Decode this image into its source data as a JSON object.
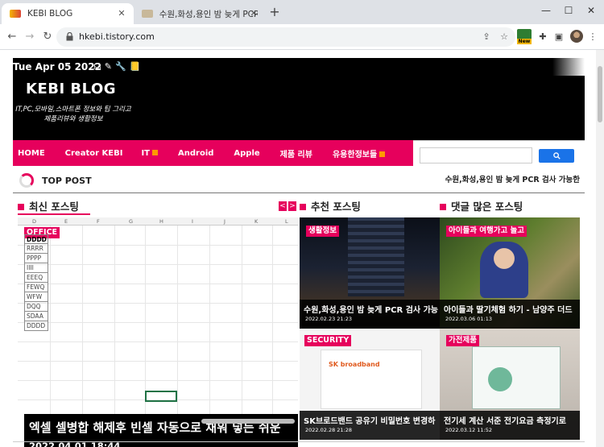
{
  "browser": {
    "tabs": [
      {
        "title": "KEBI BLOG",
        "active": true
      },
      {
        "title": "수원,화성,용인 밤 늦게 PCR 검사",
        "active": false
      }
    ],
    "new_tab": "+",
    "window_controls": [
      "—",
      "☐",
      "✕"
    ],
    "nav": {
      "back": "←",
      "forward": "→",
      "reload": "↻"
    },
    "url": "hkebi.tistory.com",
    "ext_badge": "New"
  },
  "blog": {
    "date": "Tue Apr 05 2022",
    "header_icons": "☊✎🔧📒",
    "title": "KEBI BLOG",
    "description": "IT,PC,모바일,스마트폰 정보와 팁 그리고 제품리뷰와 생활정보",
    "menu": [
      "HOME",
      "Creator KEBI",
      "IT",
      "Android",
      "Apple",
      "제품 리뷰",
      "유용한정보들"
    ],
    "search_button_icon": "search-icon",
    "search_placeholder": ""
  },
  "top_post": {
    "label": "TOP POST",
    "ticker": "수원,화성,용인 밤 늦게 PCR 검사 가능한"
  },
  "sections": {
    "latest": "최신 포스팅",
    "recommended": "추천 포스팅",
    "most_commented": "댓글 많은 포스팅",
    "prev": "<",
    "next": ">"
  },
  "latest_post": {
    "category": "OFFICE",
    "title": "엑셀 셀병합 해제후 빈셀 자동으로 채워 넣는 쉬운",
    "date": "2022.04.01 18:44",
    "sheet_columns": [
      "D",
      "E",
      "F",
      "G",
      "H",
      "I",
      "J",
      "K",
      "L"
    ],
    "cells": [
      "DDDD",
      "RRRR",
      "PPPP",
      "IIII",
      "EEEQ",
      "FEWQ",
      "WFW",
      "DQQ",
      "SDAA",
      "DDDD"
    ]
  },
  "cards": [
    {
      "category": "생활정보",
      "title": "수원,화성,용인 밤 늦게 PCR 검사 가능",
      "date": "2022.02.23 21:23"
    },
    {
      "category": "아이들과 여행가고 놀고",
      "title": "아이들과 딸기체험 하기 - 남양주 더드",
      "date": "2022.03.06 01:13"
    },
    {
      "category": "SECURITY",
      "title": "SK브로드밴드 공유기 비밀번호 변경하",
      "date": "2022.02.28 21:28",
      "image_brand": "SK broadband"
    },
    {
      "category": "가전제품",
      "title": "전기세 계산 서준 전기요금 측정기로",
      "date": "2022.03.12 11:52"
    }
  ],
  "colors": {
    "accent": "#e6005c",
    "header_bg": "#000000",
    "search_btn": "#1a73e8"
  }
}
